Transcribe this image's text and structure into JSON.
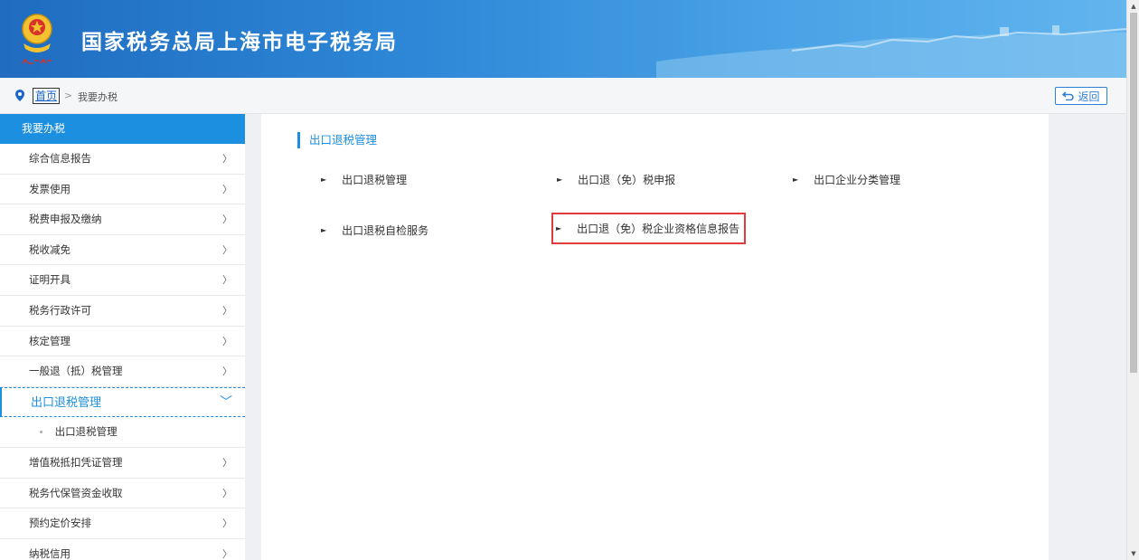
{
  "header": {
    "site_title": "国家税务总局上海市电子税务局",
    "emblem_icon": "tax-emblem-icon"
  },
  "breadcrumb": {
    "home": "首页",
    "separator": ">",
    "current": "我要办税",
    "back_label": "返回"
  },
  "sidebar": {
    "title": "我要办税",
    "items": [
      {
        "label": "综合信息报告",
        "chevron": "〉"
      },
      {
        "label": "发票使用",
        "chevron": "〉"
      },
      {
        "label": "税费申报及缴纳",
        "chevron": "〉"
      },
      {
        "label": "税收减免",
        "chevron": "〉"
      },
      {
        "label": "证明开具",
        "chevron": "〉"
      },
      {
        "label": "税务行政许可",
        "chevron": "〉"
      },
      {
        "label": "核定管理",
        "chevron": "〉"
      },
      {
        "label": "一般退（抵）税管理",
        "chevron": "〉"
      }
    ],
    "active_item": {
      "label": "出口退税管理",
      "chevron": "﹀"
    },
    "active_subitems": [
      {
        "label": "出口退税管理"
      }
    ],
    "items_after": [
      {
        "label": "增值税抵扣凭证管理",
        "chevron": "〉"
      },
      {
        "label": "税务代保管资金收取",
        "chevron": "〉"
      },
      {
        "label": "预约定价安排",
        "chevron": "〉"
      },
      {
        "label": "纳税信用",
        "chevron": "〉"
      }
    ]
  },
  "content": {
    "section_title": "出口退税管理",
    "links": [
      {
        "label": "出口退税管理",
        "arrow": "►"
      },
      {
        "label": "出口退（免）税申报",
        "arrow": "►"
      },
      {
        "label": "出口企业分类管理",
        "arrow": "►"
      },
      {
        "label": "出口退税自检服务",
        "arrow": "►"
      },
      {
        "label": "出口退（免）税企业资格信息报告",
        "arrow": "►"
      }
    ],
    "highlight_color": "#e23b3b"
  },
  "colors": {
    "accent": "#1d8fe0",
    "header_start": "#1f6cc0",
    "header_end": "#62b5ee"
  }
}
